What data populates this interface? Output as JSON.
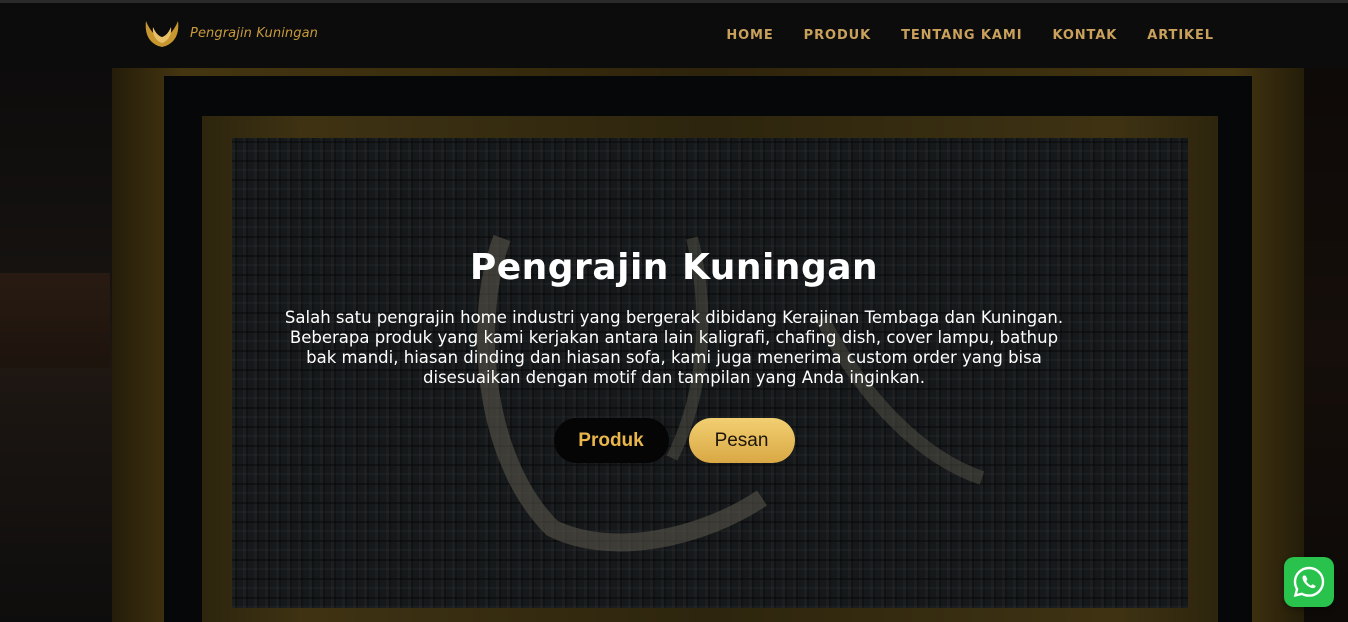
{
  "brand": {
    "name": "Pengrajin Kuningan",
    "logo_icon": "golden-wings-logo"
  },
  "nav": {
    "items": [
      {
        "label": "HOME"
      },
      {
        "label": "PRODUK"
      },
      {
        "label": "TENTANG KAMI"
      },
      {
        "label": "KONTAK"
      },
      {
        "label": "ARTIKEL"
      }
    ]
  },
  "hero": {
    "title": "Pengrajin Kuningan",
    "description": "Salah satu pengrajin home industri yang bergerak dibidang Kerajinan Tembaga dan Kuningan. Beberapa produk yang kami kerjakan antara lain kaligrafi, chafing dish, cover lampu, bathup bak mandi, hiasan dinding dan hiasan sofa, kami juga menerima custom order yang bisa disesuaikan dengan motif dan tampilan yang Anda inginkan.",
    "buttons": {
      "produk_label": "Produk",
      "pesan_label": "Pesan"
    }
  },
  "floating": {
    "whatsapp_icon": "whatsapp-icon"
  },
  "colors": {
    "nav_text": "#c9a15c",
    "brand_text": "#c79a3c",
    "accent_gold": "#e8b64a",
    "whatsapp_green": "#28c24d"
  }
}
